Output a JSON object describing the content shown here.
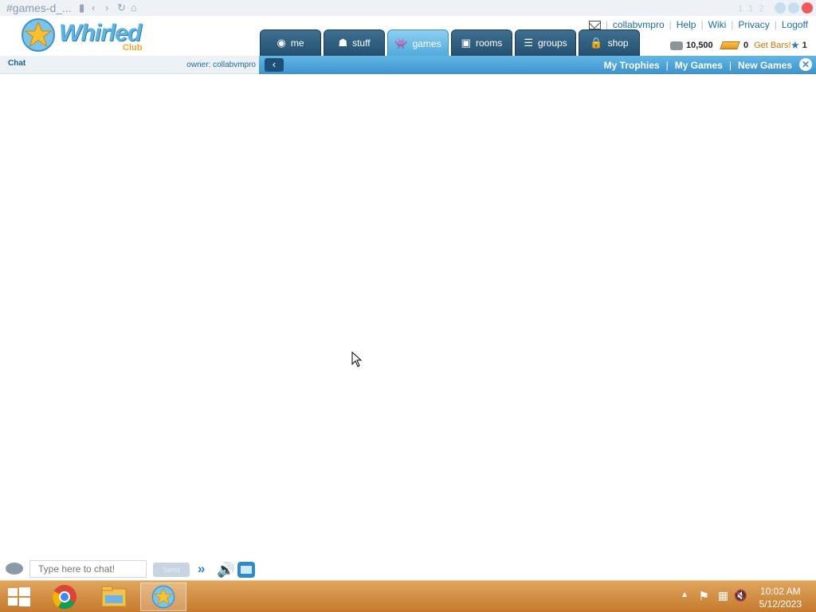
{
  "window": {
    "title": "#games-d_...",
    "version_indicator": "1 1 2",
    "buttons": {
      "close_color": "#ee5a5a",
      "min_color": "#b9d4f0"
    }
  },
  "brand": {
    "name": "Whirled",
    "sub": "Club",
    "accent": "#5fb3e0",
    "sub_color": "#f2a623"
  },
  "toplinks": {
    "mail_icon": "envelope-icon",
    "username": "collabvmpro",
    "help": "Help",
    "wiki": "Wiki",
    "privacy": "Privacy",
    "logoff": "Logoff"
  },
  "stats": {
    "coins": "10,500",
    "bars": "0",
    "get_bars": "Get Bars!",
    "level": "1"
  },
  "tabs": [
    {
      "label": "me",
      "icon": "me-icon"
    },
    {
      "label": "stuff",
      "icon": "stuff-icon"
    },
    {
      "label": "games",
      "icon": "games-icon",
      "active": true
    },
    {
      "label": "rooms",
      "icon": "rooms-icon"
    },
    {
      "label": "groups",
      "icon": "groups-icon"
    },
    {
      "label": "shop",
      "icon": "shop-icon"
    }
  ],
  "chatbar": {
    "chat_label": "Chat",
    "owner_label": "owner: collabvmpro"
  },
  "subnav": {
    "back_icon": "back-arrow-icon",
    "my_trophies": "My Trophies",
    "my_games": "My Games",
    "new_games": "New Games",
    "separator": "|"
  },
  "chat_input": {
    "placeholder": "Type here to chat!",
    "send_label": "Send"
  },
  "taskbar": {
    "time": "10:02 AM",
    "date": "5/12/2023",
    "apps": [
      "chrome-icon",
      "file-explorer-icon",
      "whirled-icon"
    ],
    "accent": "#c67a2e"
  }
}
